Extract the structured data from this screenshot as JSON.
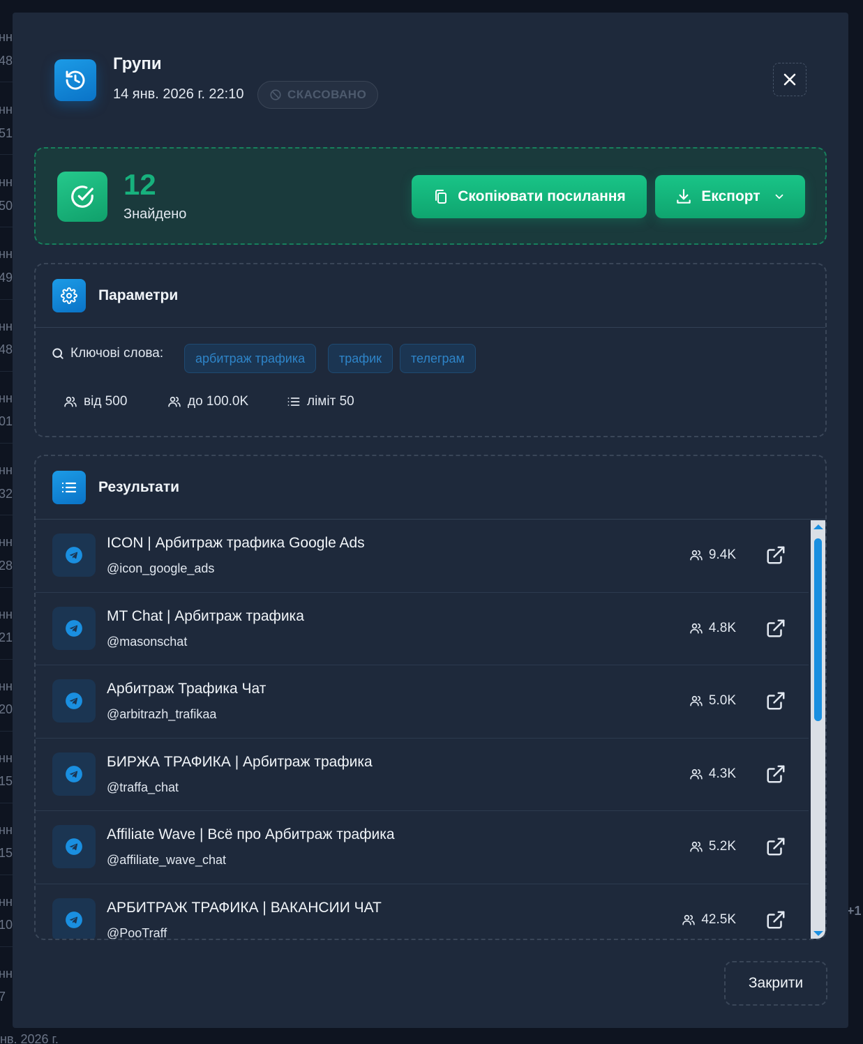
{
  "background": {
    "edge_lines": [
      "нн",
      "48",
      "нн",
      "51",
      "нн",
      "50",
      "нн",
      "49",
      "нн",
      "48",
      "нн",
      "01",
      "нн",
      "32",
      "нн",
      "28",
      "нн",
      "21",
      "нн",
      "20",
      "нн",
      "15",
      "нн",
      "15",
      "нн",
      "10",
      "нн",
      "7"
    ],
    "bottom_text": "нв. 2026 г.",
    "right_text": "+1"
  },
  "header": {
    "icon": "history-icon",
    "title": "Групи",
    "date": "14 янв. 2026 г. 22:10",
    "status": "СКАСОВАНО",
    "status_icon": "ban-icon",
    "close_icon": "close-icon"
  },
  "found": {
    "count": "12",
    "label": "Знайдено",
    "copy_button": "Скопіювати посилання",
    "export_button": "Експорт"
  },
  "params": {
    "title": "Параметри",
    "keywords_label": "Ключові слова:",
    "keywords": [
      "арбитраж трафика",
      "трафик",
      "телеграм"
    ],
    "min_label": "від 500",
    "max_label": "до 100.0K",
    "limit_label": "ліміт 50"
  },
  "results": {
    "title": "Результати",
    "items": [
      {
        "title": "ICON | Арбитраж трафика Google Ads",
        "handle": "@icon_google_ads",
        "members": "9.4K"
      },
      {
        "title": "MT Chat | Арбитраж трафика",
        "handle": "@masonschat",
        "members": "4.8K"
      },
      {
        "title": "Арбитраж Трафика Чат",
        "handle": "@arbitrazh_trafikaa",
        "members": "5.0K"
      },
      {
        "title": "БИРЖА ТРАФИКА | Арбитраж трафика",
        "handle": "@traffa_chat",
        "members": "4.3K"
      },
      {
        "title": "Affiliate Wave | Всё про Арбитраж трафика",
        "handle": "@affiliate_wave_chat",
        "members": "5.2K"
      },
      {
        "title": "АРБИТРАЖ ТРАФИКА | ВАКАНСИИ ЧАТ",
        "handle": "@PooTraff",
        "members": "42.5K"
      }
    ]
  },
  "footer": {
    "close_button": "Закрити"
  },
  "colors": {
    "accent_blue": "#1a8fe0",
    "accent_green": "#17b17d",
    "modal_bg": "#1e293b"
  }
}
